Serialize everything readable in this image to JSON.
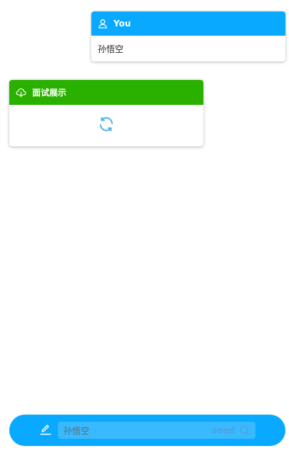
{
  "user_message": {
    "sender": "You",
    "text": "孙悟空"
  },
  "answer_card": {
    "title": "面试展示",
    "status": "loading"
  },
  "input_bar": {
    "value": "孙悟空",
    "placeholder": "",
    "send_label": "seed"
  },
  "colors": {
    "user_header": "#08a9ff",
    "answer_header": "#2ab100",
    "input_bar": "#08a9ff",
    "loading_icon": "#4fb3e8"
  },
  "icons": {
    "user_header": "user-icon",
    "answer_header": "cloud-download-icon",
    "answer_body": "refresh-icon",
    "input_left": "edit-icon",
    "input_right": "search-icon"
  }
}
